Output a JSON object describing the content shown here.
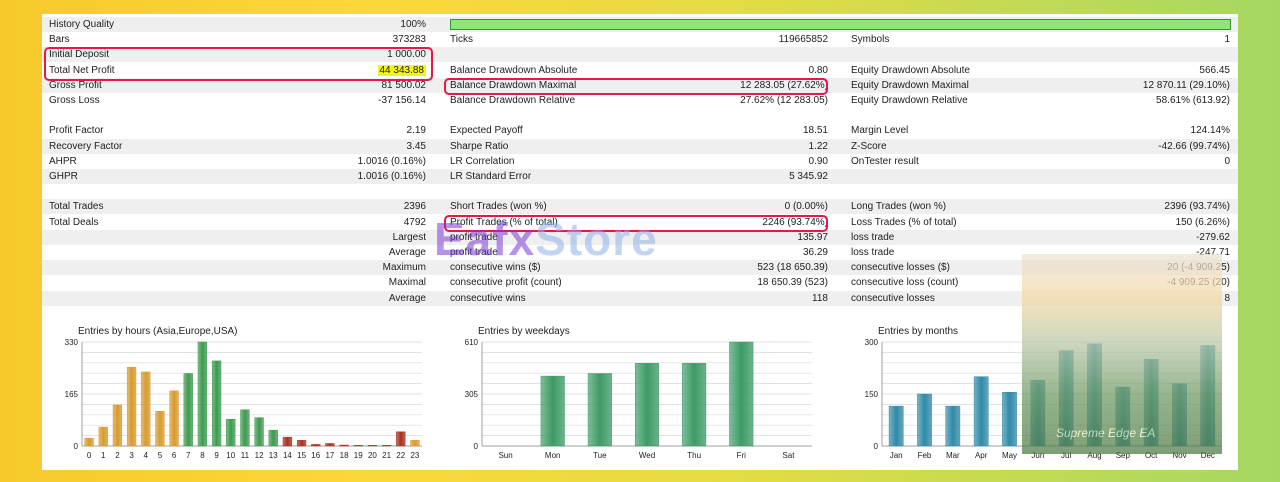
{
  "report": {
    "history_quality": {
      "label": "History Quality",
      "value": "100%",
      "quality_fraction": 1.0
    },
    "rows": [
      {
        "c1": [
          "Bars",
          "373283"
        ],
        "c2": [
          "Ticks",
          "119665852"
        ],
        "c3": [
          "Symbols",
          "1"
        ]
      },
      {
        "c1": [
          "Initial Deposit",
          "1 000.00"
        ],
        "c2": [
          "",
          ""
        ],
        "c3": [
          "",
          ""
        ]
      },
      {
        "c1": [
          "Total Net Profit",
          "44 343.88"
        ],
        "c2": [
          "Balance Drawdown Absolute",
          "0.80"
        ],
        "c3": [
          "Equity Drawdown Absolute",
          "566.45"
        ]
      },
      {
        "c1": [
          "Gross Profit",
          "81 500.02"
        ],
        "c2": [
          "Balance Drawdown Maximal",
          "12 283.05 (27.62%)"
        ],
        "c3": [
          "Equity Drawdown Maximal",
          "12 870.11 (29.10%)"
        ]
      },
      {
        "c1": [
          "Gross Loss",
          "-37 156.14"
        ],
        "c2": [
          "Balance Drawdown Relative",
          "27.62% (12 283.05)"
        ],
        "c3": [
          "Equity Drawdown Relative",
          "58.61% (613.92)"
        ]
      },
      {
        "c1": [
          "",
          ""
        ],
        "c2": [
          "",
          ""
        ],
        "c3": [
          "",
          ""
        ]
      },
      {
        "c1": [
          "Profit Factor",
          "2.19"
        ],
        "c2": [
          "Expected Payoff",
          "18.51"
        ],
        "c3": [
          "Margin Level",
          "124.14%"
        ]
      },
      {
        "c1": [
          "Recovery Factor",
          "3.45"
        ],
        "c2": [
          "Sharpe Ratio",
          "1.22"
        ],
        "c3": [
          "Z-Score",
          "-42.66 (99.74%)"
        ]
      },
      {
        "c1": [
          "AHPR",
          "1.0016 (0.16%)"
        ],
        "c2": [
          "LR Correlation",
          "0.90"
        ],
        "c3": [
          "OnTester result",
          "0"
        ]
      },
      {
        "c1": [
          "GHPR",
          "1.0016 (0.16%)"
        ],
        "c2": [
          "LR Standard Error",
          "5 345.92"
        ],
        "c3": [
          "",
          ""
        ]
      },
      {
        "c1": [
          "",
          ""
        ],
        "c2": [
          "",
          ""
        ],
        "c3": [
          "",
          ""
        ]
      },
      {
        "c1": [
          "Total Trades",
          "2396"
        ],
        "c2": [
          "Short Trades (won %)",
          "0 (0.00%)"
        ],
        "c3": [
          "Long Trades (won %)",
          "2396 (93.74%)"
        ]
      },
      {
        "c1": [
          "Total Deals",
          "4792"
        ],
        "c2": [
          "Profit Trades (% of total)",
          "2246 (93.74%)"
        ],
        "c3": [
          "Loss Trades (% of total)",
          "150 (6.26%)"
        ]
      },
      {
        "c1": [
          "Largest",
          ""
        ],
        "c2": [
          "profit trade",
          "135.97"
        ],
        "c3": [
          "loss trade",
          "-279.62"
        ],
        "right_label": true
      },
      {
        "c1": [
          "Average",
          ""
        ],
        "c2": [
          "profit trade",
          "36.29"
        ],
        "c3": [
          "loss trade",
          "-247.71"
        ],
        "right_label": true
      },
      {
        "c1": [
          "Maximum",
          ""
        ],
        "c2": [
          "consecutive wins ($)",
          "523 (18 650.39)"
        ],
        "c3": [
          "consecutive losses ($)",
          "20 (-4 909.25)"
        ],
        "right_label": true
      },
      {
        "c1": [
          "Maximal",
          ""
        ],
        "c2": [
          "consecutive profit (count)",
          "18 650.39 (523)"
        ],
        "c3": [
          "consecutive loss (count)",
          "-4 909.25 (20)"
        ],
        "right_label": true
      },
      {
        "c1": [
          "Average",
          ""
        ],
        "c2": [
          "consecutive wins",
          "118"
        ],
        "c3": [
          "consecutive losses",
          "8"
        ],
        "right_label": true
      }
    ]
  },
  "watermark": {
    "part1": "Eafx",
    "part2": "Store"
  },
  "photo_caption": "Supreme Edge EA",
  "chart_data": [
    {
      "type": "bar",
      "title": "Entries by hours (Asia,Europe,USA)",
      "categories": [
        "0",
        "1",
        "2",
        "3",
        "4",
        "5",
        "6",
        "7",
        "8",
        "9",
        "10",
        "11",
        "12",
        "13",
        "14",
        "15",
        "16",
        "17",
        "18",
        "19",
        "20",
        "21",
        "22",
        "23"
      ],
      "values": [
        25,
        60,
        130,
        250,
        235,
        110,
        175,
        230,
        330,
        270,
        85,
        115,
        90,
        50,
        28,
        18,
        5,
        8,
        3,
        2,
        2,
        2,
        45,
        18
      ],
      "colors": [
        "#d89a2e",
        "#d89a2e",
        "#d89a2e",
        "#d89a2e",
        "#d89a2e",
        "#d89a2e",
        "#d89a2e",
        "#3d9a4e",
        "#3d9a4e",
        "#3d9a4e",
        "#3d9a4e",
        "#3d9a4e",
        "#3d9a4e",
        "#3d9a4e",
        "#a8301e",
        "#a8301e",
        "#a8301e",
        "#a8301e",
        "#a8301e",
        "#a8301e",
        "#a8301e",
        "#a8301e",
        "#a8301e",
        "#d89a2e"
      ],
      "yticks": [
        "0",
        "165",
        "330"
      ],
      "ylim": [
        0,
        330
      ]
    },
    {
      "type": "bar",
      "title": "Entries by weekdays",
      "categories": [
        "Sun",
        "Mon",
        "Tue",
        "Wed",
        "Thu",
        "Fri",
        "Sat"
      ],
      "values": [
        0,
        410,
        425,
        485,
        485,
        610,
        0
      ],
      "colors": [
        "#3d9a66",
        "#3d9a66",
        "#3d9a66",
        "#3d9a66",
        "#3d9a66",
        "#3d9a66",
        "#3d9a66"
      ],
      "yticks": [
        "0",
        "305",
        "610"
      ],
      "ylim": [
        0,
        610
      ]
    },
    {
      "type": "bar",
      "title": "Entries by months",
      "categories": [
        "Jan",
        "Feb",
        "Mar",
        "Apr",
        "May",
        "Jun",
        "Jul",
        "Aug",
        "Sep",
        "Oct",
        "Nov",
        "Dec"
      ],
      "values": [
        115,
        150,
        115,
        200,
        155,
        190,
        275,
        295,
        170,
        250,
        180,
        290
      ],
      "colors": [
        "#2f8aa8",
        "#2f8aa8",
        "#2f8aa8",
        "#2f8aa8",
        "#2f8aa8",
        "#2f8aa8",
        "#2f8aa8",
        "#2f8aa8",
        "#2f8aa8",
        "#2f8aa8",
        "#2f8aa8",
        "#2f8aa8"
      ],
      "yticks": [
        "0",
        "150",
        "300"
      ],
      "ylim": [
        0,
        300
      ]
    }
  ]
}
